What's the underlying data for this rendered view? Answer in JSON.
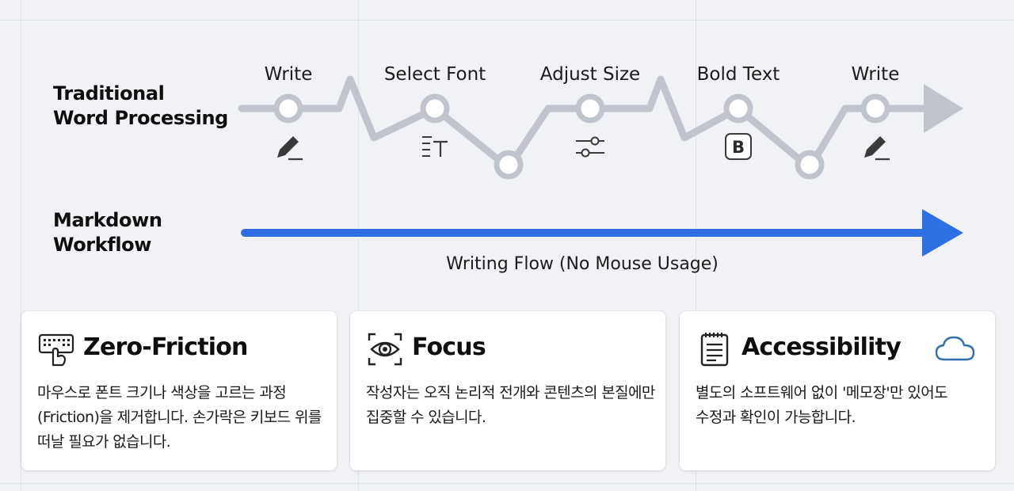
{
  "rows": {
    "traditional": {
      "line1": "Traditional",
      "line2": "Word Processing"
    },
    "markdown": {
      "line1": "Markdown",
      "line2": "Workflow"
    }
  },
  "steps": [
    {
      "label": "Write",
      "icon": "pencil-icon"
    },
    {
      "label": "Select Font",
      "icon": "font-size-icon"
    },
    {
      "label": "Adjust Size",
      "icon": "sliders-icon"
    },
    {
      "label": "Bold Text",
      "icon": "bold-icon"
    },
    {
      "label": "Write",
      "icon": "pencil-icon"
    }
  ],
  "markdown_caption": "Writing Flow (No Mouse Usage)",
  "colors": {
    "traditional_line": "#c0c4cc",
    "markdown_line": "#2f6fe4",
    "cloud_icon": "#2f6fb0"
  },
  "cards": [
    {
      "title": "Zero-Friction",
      "icon": "keyboard-hand-icon",
      "body": "마우스로 폰트 크기나 색상을 고르는 과정(Friction)을 제거합니다. 손가락은 키보드 위를 떠날 필요가 없습니다."
    },
    {
      "title": "Focus",
      "icon": "eye-icon",
      "body": "작성자는 오직 논리적 전개와 콘텐츠의 본질에만 집중할 수 있습니다."
    },
    {
      "title": "Accessibility",
      "icon": "notepad-icon",
      "extra_icon": "cloud-icon",
      "body": "별도의 소프트웨어 없이 '메모장'만 있어도 수정과 확인이 가능합니다."
    }
  ]
}
